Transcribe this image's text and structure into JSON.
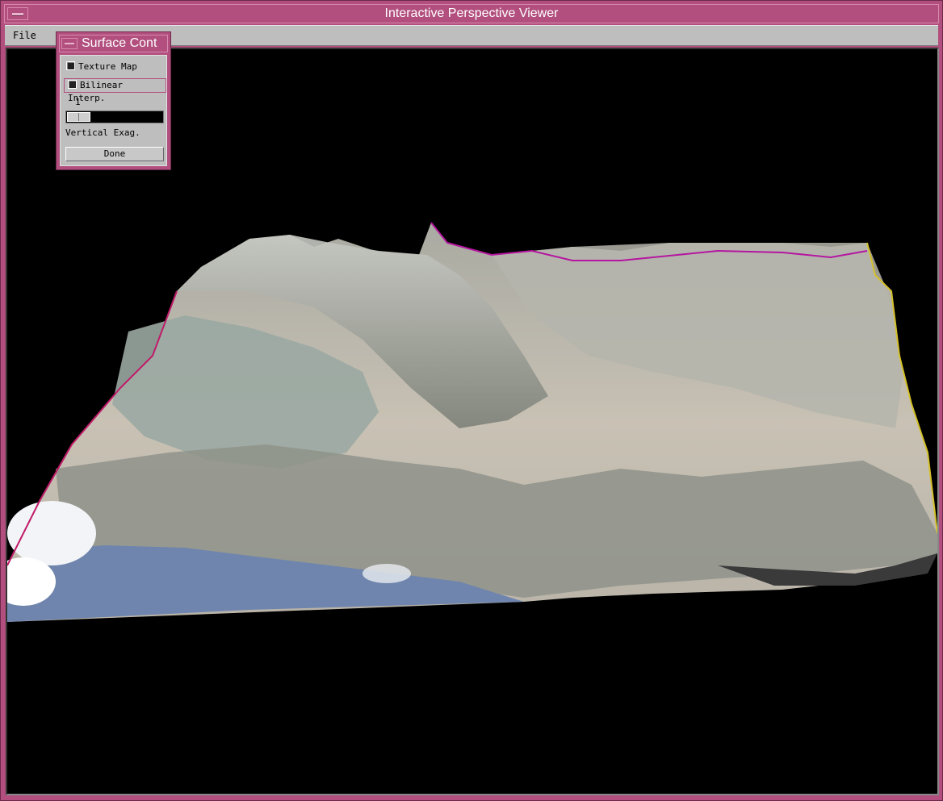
{
  "window": {
    "title": "Interactive Perspective Viewer"
  },
  "menubar": {
    "file_label": "File"
  },
  "dialog": {
    "title": "Surface Cont",
    "texture_map": {
      "label": "Texture Map",
      "checked": true
    },
    "bilinear": {
      "label": "Bilinear Interp.",
      "checked": true
    },
    "slider": {
      "value": "1",
      "label": "Vertical Exag."
    },
    "done_label": "Done"
  },
  "colors": {
    "frame": "#b24f7e",
    "panel": "#bebebe",
    "viewport": "#000000"
  }
}
